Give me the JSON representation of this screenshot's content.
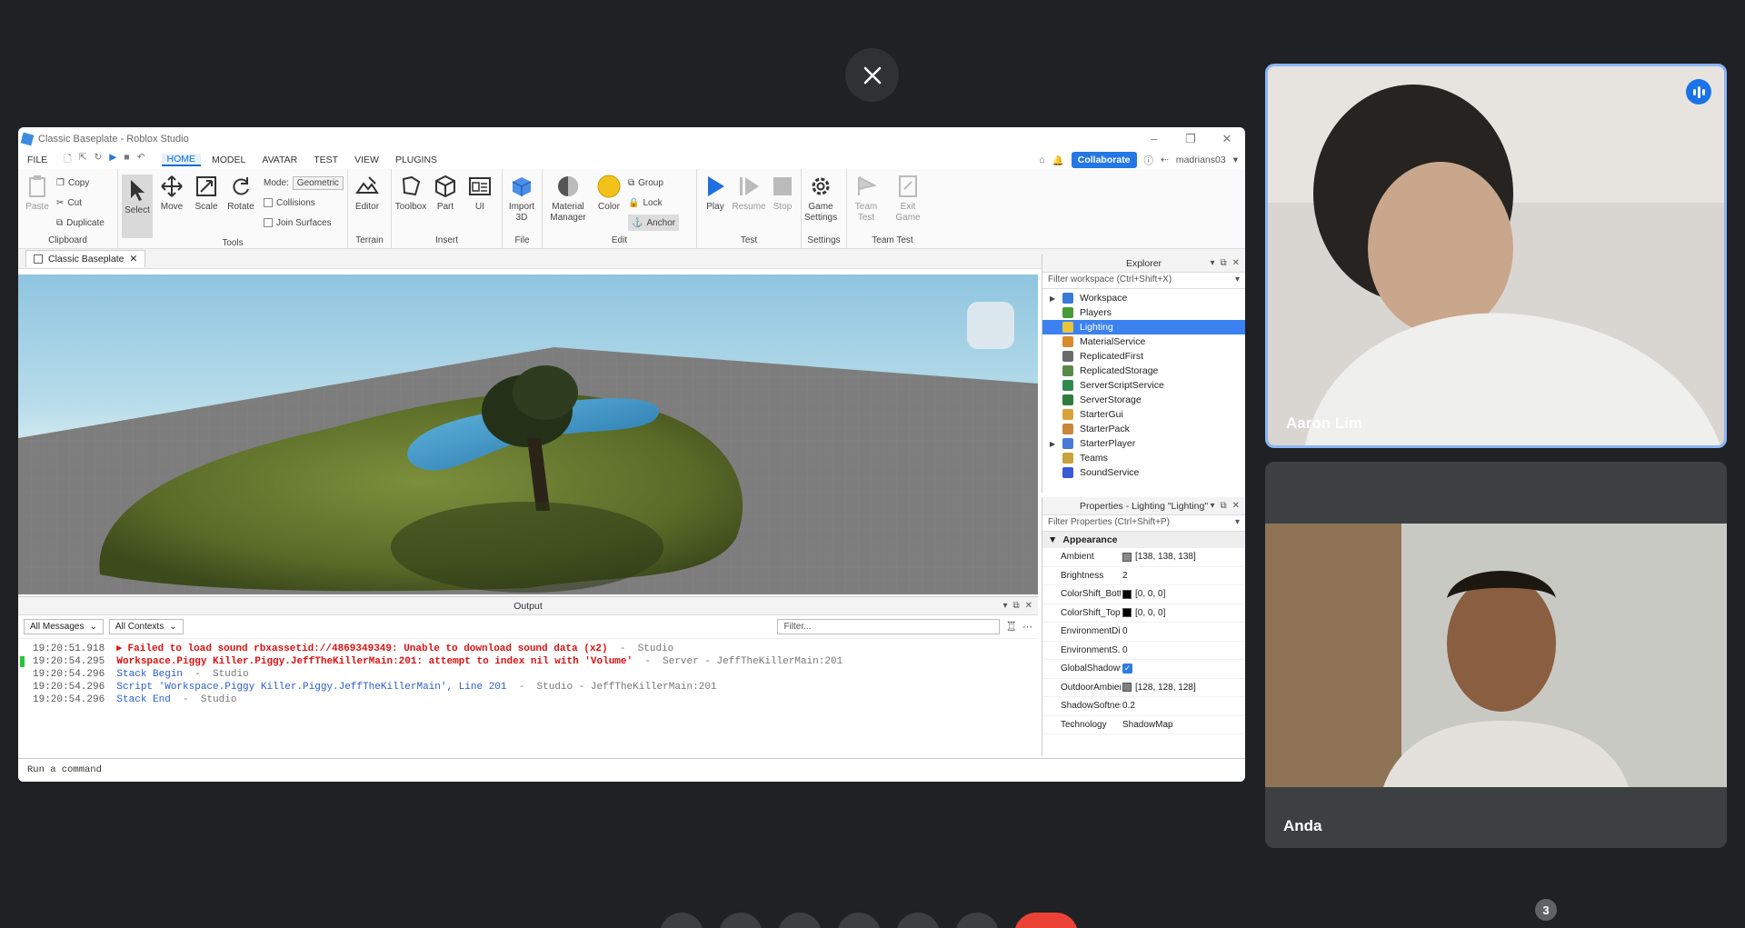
{
  "meeting": {
    "close_label": "Close",
    "participant_count": "3",
    "participants": [
      {
        "name": "Aaron Lim",
        "speaking": true
      },
      {
        "name": "Anda",
        "speaking": false
      }
    ]
  },
  "studio": {
    "window_title": "Classic Baseplate - Roblox Studio",
    "menu": [
      "FILE",
      "HOME",
      "MODEL",
      "AVATAR",
      "TEST",
      "VIEW",
      "PLUGINS"
    ],
    "active_menu": "HOME",
    "collaborate_label": "Collaborate",
    "username": "madrians03",
    "ribbon": {
      "clipboard": {
        "group": "Clipboard",
        "paste": "Paste",
        "copy": "Copy",
        "cut": "Cut",
        "duplicate": "Duplicate"
      },
      "tools": {
        "group": "Tools",
        "select": "Select",
        "move": "Move",
        "scale": "Scale",
        "rotate": "Rotate",
        "mode_label": "Mode:",
        "mode_value": "Geometric",
        "collisions": "Collisions",
        "join_surfaces": "Join Surfaces"
      },
      "terrain": {
        "group": "Terrain",
        "editor": "Editor"
      },
      "insert": {
        "group": "Insert",
        "toolbox": "Toolbox",
        "part": "Part",
        "ui": "UI"
      },
      "file": {
        "group": "File",
        "import": "Import",
        "import2": "3D"
      },
      "edit": {
        "group": "Edit",
        "material": "Material",
        "material2": "Manager",
        "color": "Color",
        "group_btn": "Group",
        "lock": "Lock",
        "anchor": "Anchor"
      },
      "test": {
        "group": "Test",
        "play": "Play",
        "resume": "Resume",
        "stop": "Stop"
      },
      "settings": {
        "group": "Settings",
        "game": "Game",
        "game2": "Settings"
      },
      "team_test": {
        "group": "Team Test",
        "team": "Team",
        "team2": "Test",
        "exit": "Exit",
        "exit2": "Game"
      }
    },
    "doc_tab": "Classic Baseplate",
    "output": {
      "title": "Output",
      "filter_messages": "All Messages",
      "filter_contexts": "All Contexts",
      "filter_placeholder": "Filter...",
      "lines": [
        {
          "ts": "19:20:51.918",
          "msg": "  ▸ Failed to load sound rbxassetid://4869349349: Unable to download sound data (x2)",
          "meta": "  -  Studio",
          "kind": "err"
        },
        {
          "ts": "19:20:54.295",
          "msg": "  Workspace.Piggy Killer.Piggy.JeffTheKillerMain:201: attempt to index nil with 'Volume'",
          "meta": "  -  Server - JeffTheKillerMain:201",
          "kind": "err"
        },
        {
          "ts": "19:20:54.296",
          "msg": "  Stack Begin",
          "meta": "  -  Studio",
          "kind": "info"
        },
        {
          "ts": "19:20:54.296",
          "msg": "  Script 'Workspace.Piggy Killer.Piggy.JeffTheKillerMain', Line 201",
          "meta": "  -  Studio - JeffTheKillerMain:201",
          "kind": "info"
        },
        {
          "ts": "19:20:54.296",
          "msg": "  Stack End",
          "meta": "  -  Studio",
          "kind": "info"
        }
      ],
      "command_placeholder": "Run a command"
    },
    "explorer": {
      "title": "Explorer",
      "filter": "Filter workspace (Ctrl+Shift+X)",
      "items": [
        {
          "name": "Workspace",
          "expand": true,
          "color": "#3a7bd5"
        },
        {
          "name": "Players",
          "expand": false,
          "color": "#4a9a3a"
        },
        {
          "name": "Lighting",
          "expand": false,
          "color": "#e8c53a",
          "selected": true
        },
        {
          "name": "MaterialService",
          "expand": false,
          "color": "#d98a2b"
        },
        {
          "name": "ReplicatedFirst",
          "expand": false,
          "color": "#6b6b6b"
        },
        {
          "name": "ReplicatedStorage",
          "expand": false,
          "color": "#5a8a4a"
        },
        {
          "name": "ServerScriptService",
          "expand": false,
          "color": "#2f8a4f"
        },
        {
          "name": "ServerStorage",
          "expand": false,
          "color": "#2f7a3f"
        },
        {
          "name": "StarterGui",
          "expand": false,
          "color": "#d9a23a"
        },
        {
          "name": "StarterPack",
          "expand": false,
          "color": "#c8873a"
        },
        {
          "name": "StarterPlayer",
          "expand": true,
          "color": "#4a7ad5"
        },
        {
          "name": "Teams",
          "expand": false,
          "color": "#c8a23a"
        },
        {
          "name": "SoundService",
          "expand": false,
          "color": "#3a5ad5"
        }
      ]
    },
    "properties": {
      "title": "Properties - Lighting \"Lighting\"",
      "filter": "Filter Properties (Ctrl+Shift+P)",
      "section": "Appearance",
      "rows": [
        {
          "name": "Ambient",
          "value": "[138, 138, 138]",
          "swatch": "#8a8a8a"
        },
        {
          "name": "Brightness",
          "value": "2"
        },
        {
          "name": "ColorShift_Bott...",
          "value": "[0, 0, 0]",
          "swatch": "#000000"
        },
        {
          "name": "ColorShift_Top",
          "value": "[0, 0, 0]",
          "swatch": "#000000"
        },
        {
          "name": "EnvironmentDi...",
          "value": "0"
        },
        {
          "name": "EnvironmentS...",
          "value": "0"
        },
        {
          "name": "GlobalShadows",
          "value": "",
          "checked": true
        },
        {
          "name": "OutdoorAmbient",
          "value": "[128, 128, 128]",
          "swatch": "#808080"
        },
        {
          "name": "ShadowSoftness",
          "value": "0.2"
        },
        {
          "name": "Technology",
          "value": "ShadowMap"
        }
      ]
    }
  }
}
